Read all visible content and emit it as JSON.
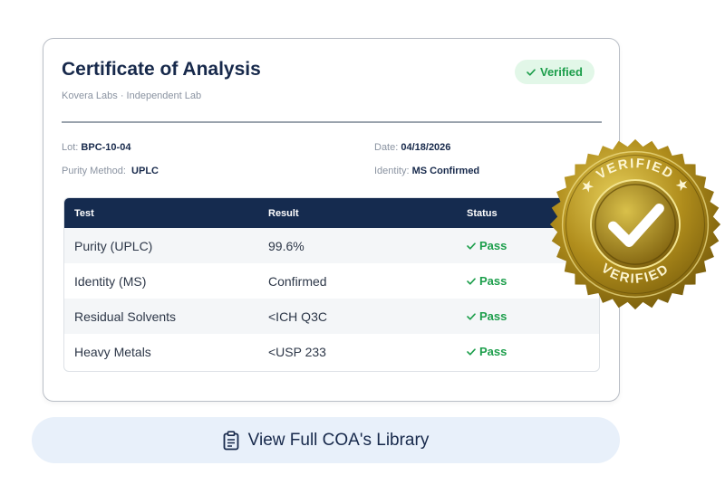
{
  "card": {
    "title": "Certificate of Analysis",
    "subtitle": "Kovera Labs · Independent Lab",
    "badge": "Verified"
  },
  "meta": {
    "lot_label": "Lot:",
    "lot_value": "BPC-10-04",
    "date_label": "Date:",
    "date_value": "04/18/2026",
    "method_label": "Purity Method:",
    "method_value": "UPLC",
    "identity_label": "Identity:",
    "identity_value": "MS Confirmed"
  },
  "table": {
    "headers": [
      "Test",
      "Result",
      "Status"
    ],
    "rows": [
      {
        "test": "Purity (UPLC)",
        "result": "99.6%",
        "status": "Pass"
      },
      {
        "test": "Identity (MS)",
        "result": "Confirmed",
        "status": "Pass"
      },
      {
        "test": "Residual Solvents",
        "result": "<ICH Q3C",
        "status": "Pass"
      },
      {
        "test": "Heavy Metals",
        "result": "<USP 233",
        "status": "Pass"
      }
    ]
  },
  "seal": {
    "text": "VERIFIED",
    "icon": "check-icon"
  },
  "library_button": {
    "label": "View Full COA's Library",
    "icon": "clipboard-icon"
  },
  "colors": {
    "navy": "#152b4f",
    "pass_green": "#1c9e4b",
    "badge_bg": "#e2f7e8",
    "seal_gold": "#b08d1c"
  }
}
